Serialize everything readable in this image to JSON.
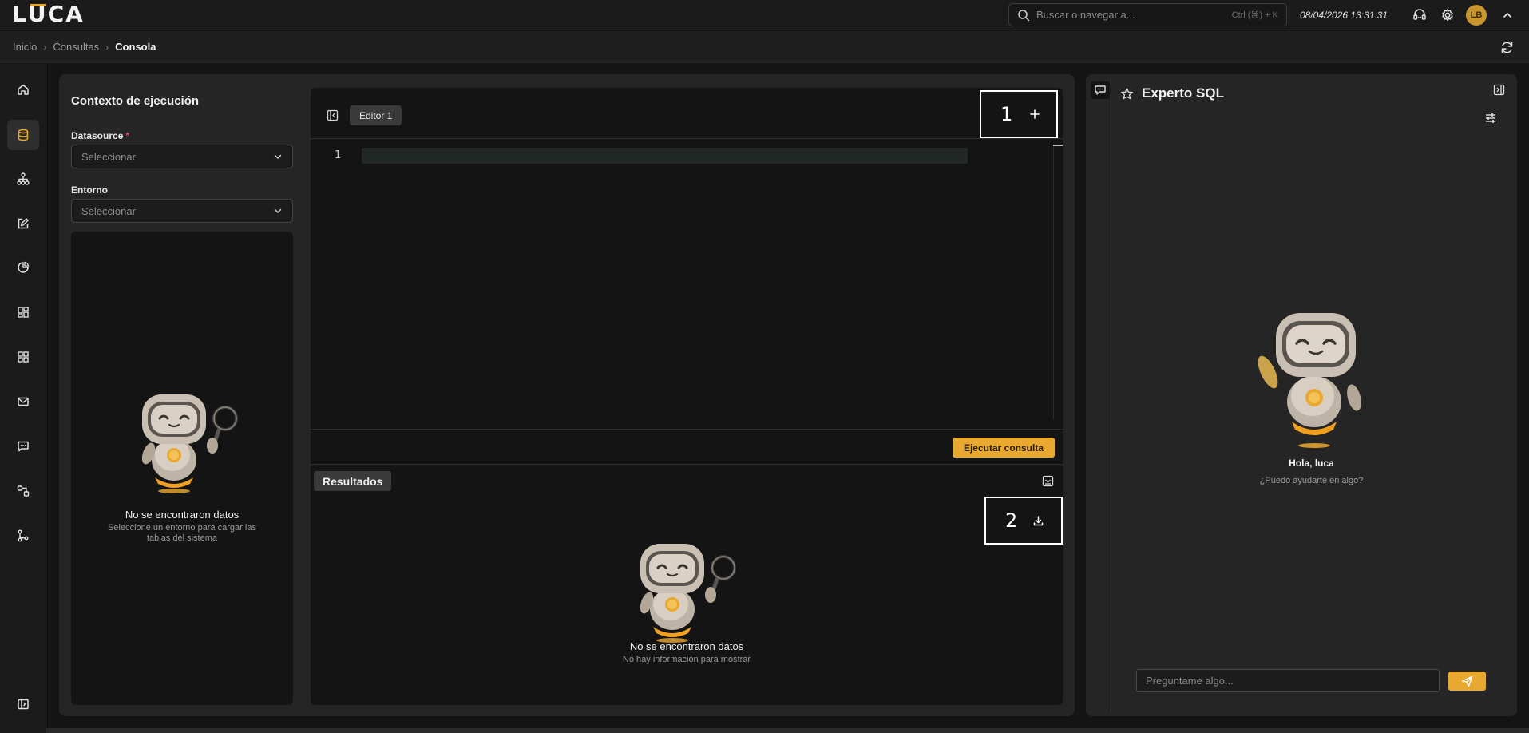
{
  "app": {
    "logo": "LUCA",
    "accent": "#e9a830"
  },
  "topbar": {
    "search_placeholder": "Buscar o navegar a...",
    "search_hint": "Ctrl (⌘) + K",
    "datetime": "08/04/2026 13:31:31",
    "user_initials": "LB",
    "icons": [
      "search-icon",
      "support-icon",
      "gear-icon",
      "chevron-up-icon"
    ]
  },
  "breadcrumb": {
    "items": [
      "Inicio",
      "Consultas"
    ],
    "current": "Consola"
  },
  "leftnav": {
    "icons": [
      "home-icon",
      "database-icon",
      "hierarchy-icon",
      "edit-icon",
      "pie-chart-icon",
      "layout-icon",
      "grid-icon",
      "mail-icon",
      "chat-icon",
      "workflow-icon",
      "git-branch-icon",
      "sidebar-toggle-icon"
    ],
    "active": "database-icon"
  },
  "context": {
    "title": "Contexto de ejecución",
    "datasource_label": "Datasource",
    "datasource_required": "*",
    "datasource_value": "Seleccionar",
    "environment_label": "Entorno",
    "environment_value": "Seleccionar",
    "empty_title": "No se encontraron datos",
    "empty_subtitle": "Seleccione un entorno para cargar las tablas del sistema"
  },
  "editor": {
    "tab_label": "Editor 1",
    "line_number": "1",
    "code": "",
    "marker_1": "1",
    "marker_2": "2",
    "run_label": "Ejecutar consulta"
  },
  "results": {
    "title": "Resultados",
    "empty_title": "No se encontraron datos",
    "empty_subtitle": "No hay información para mostrar"
  },
  "assistant": {
    "title": "Experto SQL",
    "greeting": "Hola, luca",
    "subtitle": "¿Puedo ayudarte en algo?",
    "input_placeholder": "Preguntame algo..."
  }
}
